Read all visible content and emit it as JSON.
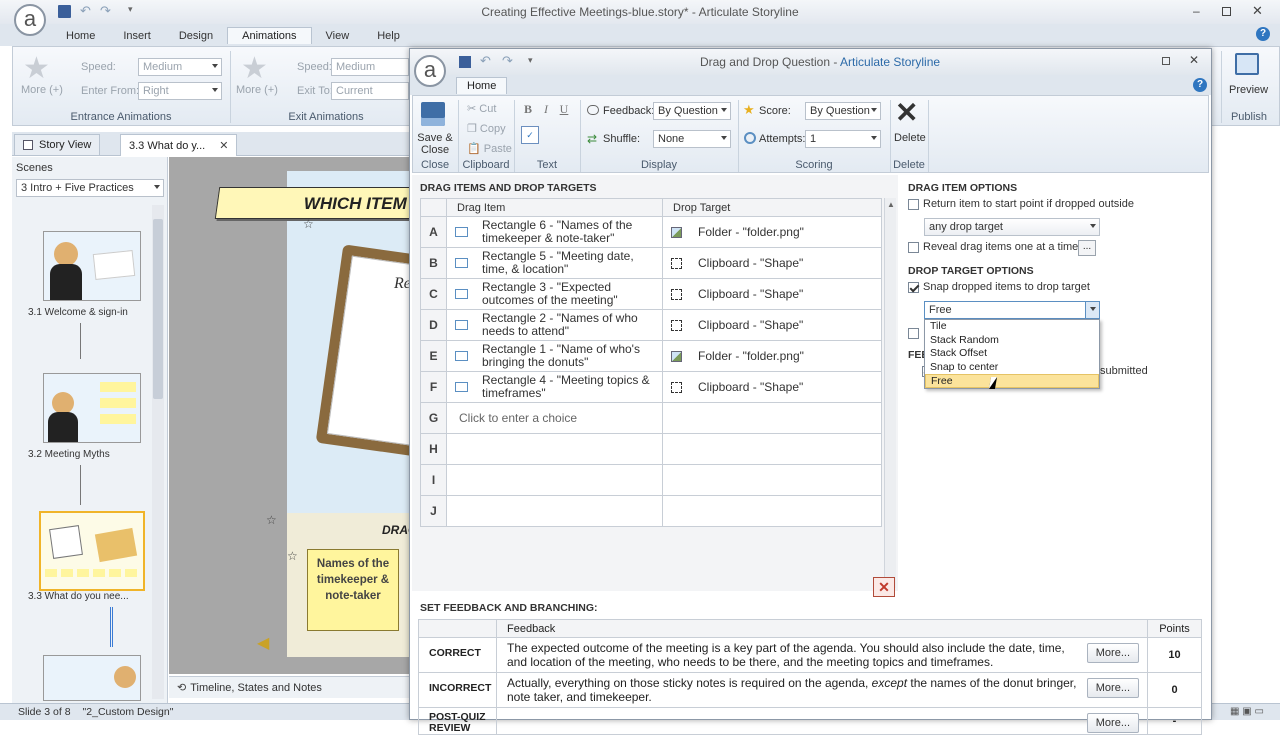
{
  "main": {
    "title": "Creating Effective Meetings-blue.story* - Articulate Storyline",
    "tabs": [
      "Home",
      "Insert",
      "Design",
      "Animations",
      "View",
      "Help"
    ],
    "entrance": {
      "speed_label": "Speed:",
      "speed_value": "Medium",
      "enter_label": "Enter From:",
      "enter_value": "Right",
      "more": "More (+)",
      "group": "Entrance Animations"
    },
    "exit": {
      "speed_label": "Speed:",
      "speed_value": "Medium",
      "exit_label": "Exit To:",
      "exit_value": "Current",
      "more": "More (+)",
      "group": "Exit Animations"
    },
    "preview": {
      "label": "Preview",
      "group": "Publish"
    },
    "view_tabs": [
      "Story View",
      "3.3 What do y..."
    ],
    "scenes_label": "Scenes",
    "scene_select": "3 Intro + Five Practices",
    "slides": [
      "3.1 Welcome & sign-in",
      "3.2 Meeting Myths",
      "3.3 What do you nee..."
    ],
    "canvas": {
      "banner": "WHICH ITEM",
      "sticky": "Names of the timekeeper & note-taker",
      "drag_text": "DRAG",
      "re_text": "Re"
    },
    "timeline_label": "Timeline, States and Notes",
    "status": {
      "slide": "Slide 3 of 8",
      "design": "\"2_Custom Design\""
    }
  },
  "dialog": {
    "title_left": "Drag and Drop Question - ",
    "title_right": "Articulate Storyline",
    "tab": "Home",
    "ribbon": {
      "save_close": "Save & Close",
      "cut": "Cut",
      "copy": "Copy",
      "paste": "Paste",
      "bold": "B",
      "italic": "I",
      "underline": "U",
      "feedback_label": "Feedback:",
      "feedback_value": "By Question",
      "shuffle_label": "Shuffle:",
      "shuffle_value": "None",
      "score_label": "Score:",
      "score_value": "By Question",
      "attempts_label": "Attempts:",
      "attempts_value": "1",
      "delete": "Delete",
      "groups": [
        "Close",
        "Clipboard",
        "Text",
        "Display",
        "Scoring",
        "Delete"
      ]
    },
    "items_header": "DRAG ITEMS AND DROP TARGETS",
    "columns": [
      "Drag Item",
      "Drop Target"
    ],
    "rows": [
      {
        "letter": "A",
        "item": "Rectangle 6 - \"Names of the timekeeper & note-taker\"",
        "target": "Folder - \"folder.png\"",
        "icon": "image"
      },
      {
        "letter": "B",
        "item": "Rectangle 5 - \"Meeting date, time, & location\"",
        "target": "Clipboard - \"Shape\"",
        "icon": "shape"
      },
      {
        "letter": "C",
        "item": "Rectangle 3 - \"Expected outcomes of the meeting\"",
        "target": "Clipboard - \"Shape\"",
        "icon": "shape"
      },
      {
        "letter": "D",
        "item": "Rectangle 2 - \"Names of who needs to attend\"",
        "target": "Clipboard - \"Shape\"",
        "icon": "shape"
      },
      {
        "letter": "E",
        "item": "Rectangle 1 - \"Name of who's bringing the donuts\"",
        "target": "Folder - \"folder.png\"",
        "icon": "image"
      },
      {
        "letter": "F",
        "item": "Rectangle 4 - \"Meeting topics & timeframes\"",
        "target": "Clipboard - \"Shape\"",
        "icon": "shape"
      }
    ],
    "empty_rows": [
      "G",
      "H",
      "I",
      "J"
    ],
    "choice_placeholder": "Click to enter a choice",
    "drag_options": {
      "header": "DRAG ITEM OPTIONS",
      "return_label": "Return item to start point if dropped outside",
      "return_value": "any drop target",
      "reveal_label": "Reveal drag items one at a time",
      "reveal_btn": "..."
    },
    "drop_options": {
      "header": "DROP TARGET OPTIONS",
      "snap_label": "Snap dropped items to drop target",
      "snap_value": "Free",
      "options": [
        "Tile",
        "Stack Random",
        "Stack Offset",
        "Snap to center",
        "Free"
      ],
      "fee_partial": "FEE",
      "submitted_partial": "submitted"
    },
    "feedback": {
      "header": "SET FEEDBACK AND BRANCHING:",
      "columns": [
        "Feedback",
        "Points"
      ],
      "rows": [
        {
          "label": "CORRECT",
          "text_before": "The expected outcome of the meeting is a key part of the agenda. You should also include the date, time, and location of the meeting, who needs to be there, and the meeting topics and timeframes.",
          "text_em": "",
          "text_after": "",
          "more": "More...",
          "points": "10"
        },
        {
          "label": "INCORRECT",
          "text_before": "Actually, everything on those sticky notes is required on the agenda, ",
          "text_em": "except",
          "text_after": " the names of the donut bringer, note taker, and timekeeper.",
          "more": "More...",
          "points": "0"
        },
        {
          "label": "POST-QUIZ REVIEW",
          "text_before": "",
          "text_em": "",
          "text_after": "",
          "more": "More...",
          "points": "-"
        }
      ]
    }
  },
  "colors": {
    "accent": "#1f6db5",
    "ribbon_bg": "#e4ebf3",
    "dropdown_highlight": "#fbe39b"
  }
}
